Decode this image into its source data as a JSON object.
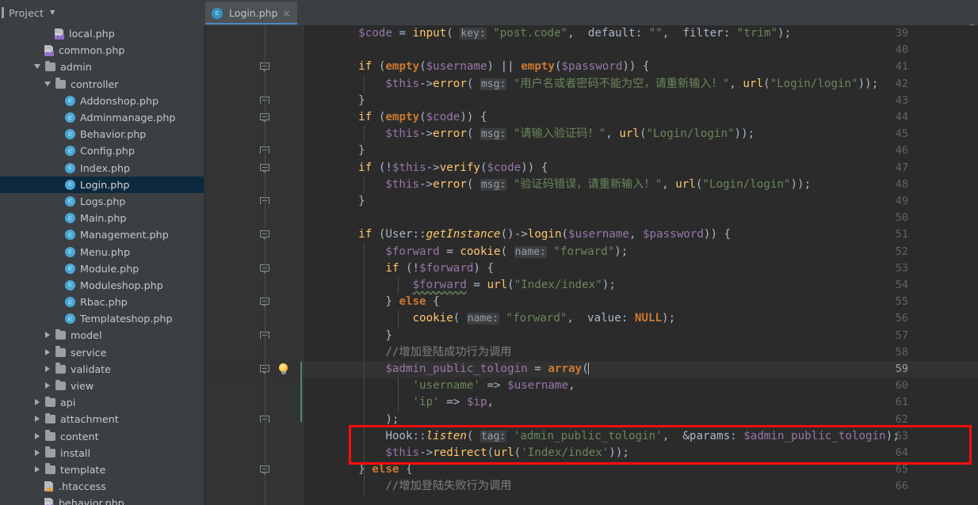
{
  "window": {
    "project_panel_title": "Project",
    "toolbar_icons": [
      "locate-icon",
      "collapse-all-icon",
      "settings-gear-icon",
      "hide-panel-icon"
    ]
  },
  "tabs": [
    {
      "label": "Login.php",
      "icon": "php-class-icon",
      "active": true,
      "close_label": "×"
    }
  ],
  "tree": [
    {
      "label": "local.php",
      "indent": 5,
      "kind": "php-file",
      "arrow": "none"
    },
    {
      "label": "common.php",
      "indent": 4,
      "kind": "php-file",
      "arrow": "none"
    },
    {
      "label": "admin",
      "indent": 3,
      "kind": "folder",
      "arrow": "open"
    },
    {
      "label": "controller",
      "indent": 4,
      "kind": "folder",
      "arrow": "open"
    },
    {
      "label": "Addonshop.php",
      "indent": 6,
      "kind": "php-class",
      "arrow": "none"
    },
    {
      "label": "Adminmanage.php",
      "indent": 6,
      "kind": "php-class",
      "arrow": "none"
    },
    {
      "label": "Behavior.php",
      "indent": 6,
      "kind": "php-class",
      "arrow": "none"
    },
    {
      "label": "Config.php",
      "indent": 6,
      "kind": "php-class",
      "arrow": "none"
    },
    {
      "label": "Index.php",
      "indent": 6,
      "kind": "php-class",
      "arrow": "none"
    },
    {
      "label": "Login.php",
      "indent": 6,
      "kind": "php-class",
      "arrow": "none",
      "selected": true
    },
    {
      "label": "Logs.php",
      "indent": 6,
      "kind": "php-class",
      "arrow": "none"
    },
    {
      "label": "Main.php",
      "indent": 6,
      "kind": "php-class",
      "arrow": "none"
    },
    {
      "label": "Management.php",
      "indent": 6,
      "kind": "php-class",
      "arrow": "none"
    },
    {
      "label": "Menu.php",
      "indent": 6,
      "kind": "php-class",
      "arrow": "none"
    },
    {
      "label": "Module.php",
      "indent": 6,
      "kind": "php-class",
      "arrow": "none"
    },
    {
      "label": "Moduleshop.php",
      "indent": 6,
      "kind": "php-class",
      "arrow": "none"
    },
    {
      "label": "Rbac.php",
      "indent": 6,
      "kind": "php-class",
      "arrow": "none"
    },
    {
      "label": "Templateshop.php",
      "indent": 6,
      "kind": "php-class",
      "arrow": "none"
    },
    {
      "label": "model",
      "indent": 4,
      "kind": "folder",
      "arrow": "closed"
    },
    {
      "label": "service",
      "indent": 4,
      "kind": "folder",
      "arrow": "closed"
    },
    {
      "label": "validate",
      "indent": 4,
      "kind": "folder",
      "arrow": "closed"
    },
    {
      "label": "view",
      "indent": 4,
      "kind": "folder",
      "arrow": "closed"
    },
    {
      "label": "api",
      "indent": 3,
      "kind": "folder",
      "arrow": "closed"
    },
    {
      "label": "attachment",
      "indent": 3,
      "kind": "folder",
      "arrow": "closed"
    },
    {
      "label": "content",
      "indent": 3,
      "kind": "folder",
      "arrow": "closed"
    },
    {
      "label": "install",
      "indent": 3,
      "kind": "folder",
      "arrow": "closed"
    },
    {
      "label": "template",
      "indent": 3,
      "kind": "folder",
      "arrow": "closed"
    },
    {
      "label": ".htaccess",
      "indent": 4,
      "kind": "htaccess",
      "arrow": "none"
    },
    {
      "label": "behavior.php",
      "indent": 4,
      "kind": "php-file",
      "arrow": "none"
    }
  ],
  "editor": {
    "first_line": 39,
    "last_line": 66,
    "current_line": 59,
    "line_numbers": [
      39,
      40,
      41,
      42,
      43,
      44,
      45,
      46,
      47,
      48,
      49,
      50,
      51,
      52,
      53,
      54,
      55,
      56,
      57,
      58,
      59,
      60,
      61,
      62,
      63,
      64,
      65,
      66
    ],
    "fold_lines": [
      41,
      43,
      44,
      46,
      47,
      49,
      51,
      53,
      55,
      57,
      59,
      62,
      65
    ],
    "highlight_color": "#ff0d0d",
    "lines": [
      {
        "n": 39,
        "text": "    $code = input( key: \"post.code\",  default: \"\",  filter: \"trim\");"
      },
      {
        "n": 40,
        "text": ""
      },
      {
        "n": 41,
        "text": "    if (empty($username) || empty($password)) {"
      },
      {
        "n": 42,
        "text": "        $this->error( msg: \"用户名或者密码不能为空，请重新输入！\", url(\"Login/login\"));"
      },
      {
        "n": 43,
        "text": "    }"
      },
      {
        "n": 44,
        "text": "    if (empty($code)) {"
      },
      {
        "n": 45,
        "text": "        $this->error( msg: \"请输入验证码！\", url(\"Login/login\"));"
      },
      {
        "n": 46,
        "text": "    }"
      },
      {
        "n": 47,
        "text": "    if (!$this->verify($code)) {"
      },
      {
        "n": 48,
        "text": "        $this->error( msg: \"验证码错误，请重新输入！\", url(\"Login/login\"));"
      },
      {
        "n": 49,
        "text": "    }"
      },
      {
        "n": 50,
        "text": ""
      },
      {
        "n": 51,
        "text": "    if (User::getInstance()->login($username, $password)) {"
      },
      {
        "n": 52,
        "text": "        $forward = cookie( name: \"forward\");"
      },
      {
        "n": 53,
        "text": "        if (!$forward) {"
      },
      {
        "n": 54,
        "text": "            $forward = url(\"Index/index\");"
      },
      {
        "n": 55,
        "text": "        } else {"
      },
      {
        "n": 56,
        "text": "            cookie( name: \"forward\",  value: NULL);"
      },
      {
        "n": 57,
        "text": "        }"
      },
      {
        "n": 58,
        "text": "        //增加登陆成功行为调用"
      },
      {
        "n": 59,
        "text": "        $admin_public_tologin = array("
      },
      {
        "n": 60,
        "text": "            'username' => $username,"
      },
      {
        "n": 61,
        "text": "            'ip' => $ip,"
      },
      {
        "n": 62,
        "text": "        );"
      },
      {
        "n": 63,
        "text": "        Hook::listen( tag: 'admin_public_tologin',  &params: $admin_public_tologin);"
      },
      {
        "n": 64,
        "text": "        $this->redirect(url('Index/index'));"
      },
      {
        "n": 65,
        "text": "    } else {"
      },
      {
        "n": 66,
        "text": "        //增加登陆失败行为调用"
      }
    ]
  }
}
